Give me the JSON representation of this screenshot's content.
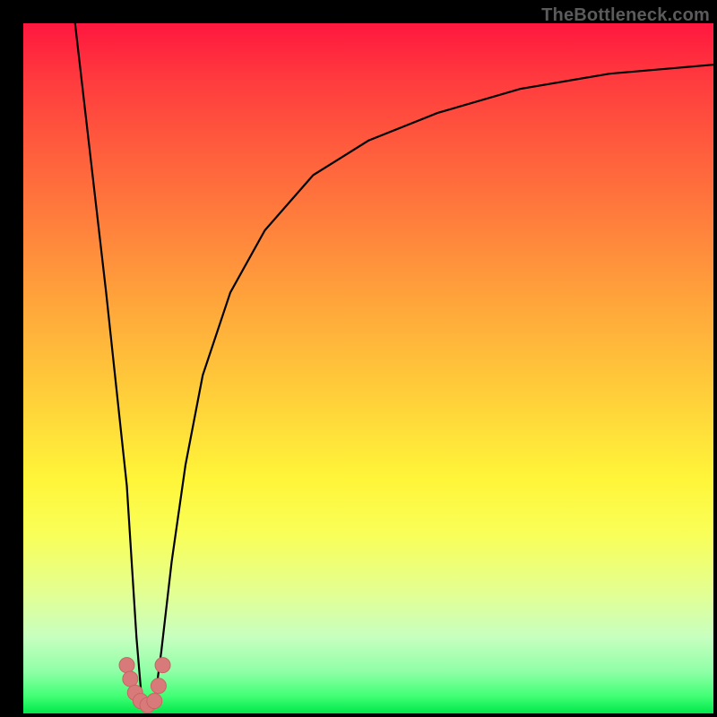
{
  "attribution": "TheBottleneck.com",
  "chart_data": {
    "type": "line",
    "title": "",
    "xlabel": "",
    "ylabel": "",
    "xlim": [
      0,
      100
    ],
    "ylim": [
      0,
      100
    ],
    "grid": false,
    "legend": false,
    "color_gradient_stops": [
      {
        "pos_pct": 0,
        "color": "#ff173f"
      },
      {
        "pos_pct": 50,
        "color": "#ffc63a"
      },
      {
        "pos_pct": 75,
        "color": "#f9ff58"
      },
      {
        "pos_pct": 100,
        "color": "#00e84a"
      }
    ],
    "series": [
      {
        "name": "bottleneck-curve-left",
        "x": [
          7.5,
          9.0,
          10.5,
          12.0,
          13.5,
          15.0,
          15.7,
          16.4,
          17.2
        ],
        "y": [
          100,
          87,
          74,
          61,
          47,
          33,
          22,
          11,
          1.5
        ]
      },
      {
        "name": "bottleneck-curve-right",
        "x": [
          19.0,
          20.0,
          21.5,
          23.5,
          26.0,
          30.0,
          35.0,
          42.0,
          50.0,
          60.0,
          72.0,
          85.0,
          100.0
        ],
        "y": [
          1.5,
          9,
          22,
          36,
          49,
          61,
          70,
          78,
          83,
          87,
          90.5,
          92.7,
          94
        ]
      }
    ],
    "markers": [
      {
        "name": "left-cluster-1",
        "x": 15.0,
        "y": 7.0
      },
      {
        "name": "left-cluster-2",
        "x": 15.5,
        "y": 5.0
      },
      {
        "name": "left-cluster-3",
        "x": 16.2,
        "y": 3.0
      },
      {
        "name": "left-cluster-4",
        "x": 17.0,
        "y": 1.8
      },
      {
        "name": "left-cluster-5",
        "x": 18.0,
        "y": 1.2
      },
      {
        "name": "right-cluster-1",
        "x": 19.0,
        "y": 1.8
      },
      {
        "name": "right-cluster-2",
        "x": 19.6,
        "y": 4.0
      },
      {
        "name": "right-cluster-3",
        "x": 20.2,
        "y": 7.0
      }
    ],
    "curve_color": "#000000",
    "marker_color": "#d97a7a",
    "marker_stroke": "#c96464"
  }
}
